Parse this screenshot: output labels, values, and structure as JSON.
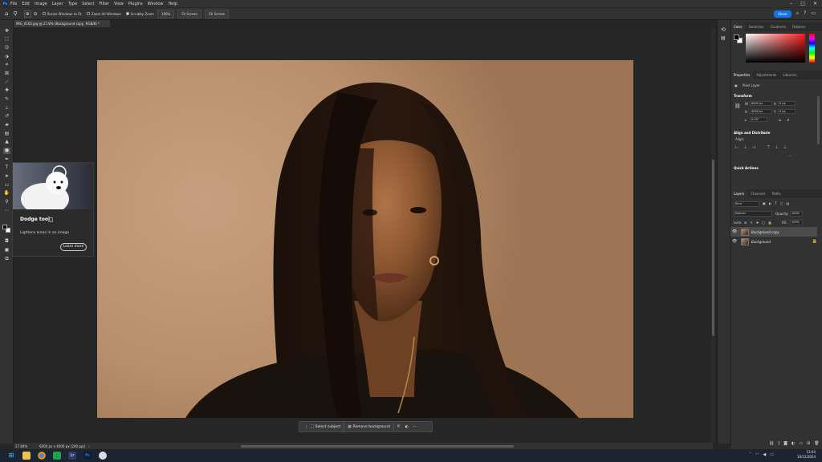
{
  "app": {
    "logo_text": "Ps"
  },
  "menu": [
    "File",
    "Edit",
    "Image",
    "Layer",
    "Type",
    "Select",
    "Filter",
    "View",
    "Plugins",
    "Window",
    "Help"
  ],
  "window_controls": [
    "–",
    "□",
    "✕"
  ],
  "options_bar": {
    "resize_windows": "Resize Windows to Fit",
    "zoom_all": "Zoom All Windows",
    "scrubby_zoom": "Scrubby Zoom",
    "zoom_100": "100%",
    "fit_screen": "Fit Screen",
    "fill_screen": "Fill Screen",
    "share": "Share"
  },
  "document": {
    "tab_title": "IMG_0165.jpg @ 27.8% (Background copy, RGB/8) *"
  },
  "tooltip": {
    "title": "Dodge tool",
    "description": "Lightens areas in an image",
    "learn_more": "Learn more"
  },
  "context_bar": {
    "select_subject": "Select subject",
    "remove_background": "Remove background"
  },
  "status": {
    "zoom": "27.84%",
    "doc_info": "6000 px x 4000 px (240 ppi)"
  },
  "color_panel": {
    "tabs": [
      "Color",
      "Swatches",
      "Gradients",
      "Patterns"
    ]
  },
  "properties_panel": {
    "tabs": [
      "Properties",
      "Adjustments",
      "Libraries"
    ],
    "layer_type": "Pixel Layer",
    "transform_label": "Transform",
    "w_label": "W",
    "w_value": "6000 px",
    "h_label": "H",
    "h_value": "4000 px",
    "x_label": "X",
    "x_value": "0 px",
    "y_label": "Y",
    "y_value": "0 px",
    "angle": "0.00°",
    "align_label": "Align and Distribute",
    "align_sub": "Align:",
    "quick_actions": "Quick Actions"
  },
  "layers_panel": {
    "tabs": [
      "Layers",
      "Channels",
      "Paths"
    ],
    "filter_kind": "Kind",
    "blend_mode": "Normal",
    "opacity_label": "Opacity:",
    "opacity_value": "100%",
    "lock_label": "Lock:",
    "fill_label": "Fill:",
    "fill_value": "100%",
    "layers": [
      {
        "name": "Background copy",
        "selected": true
      },
      {
        "name": "Background",
        "selected": false
      }
    ]
  },
  "taskbar": {
    "time": "13:03",
    "date": "10/12/2024"
  }
}
